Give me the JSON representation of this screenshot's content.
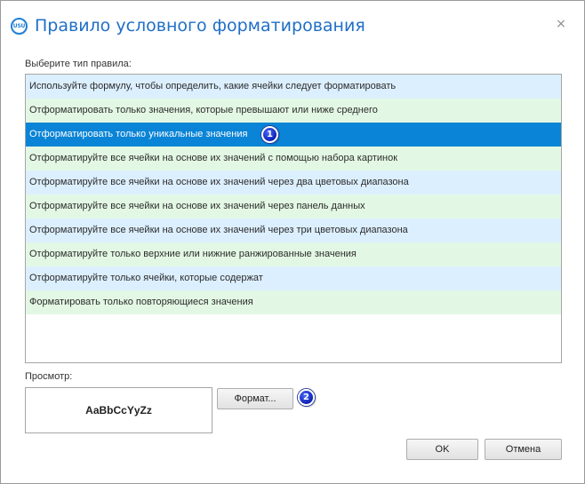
{
  "window": {
    "icon_text": "USU",
    "title": "Правило условного форматирования",
    "close_glyph": "×"
  },
  "rule_type_label": "Выберите тип правила:",
  "rules": [
    {
      "label": "Используйте формулу, чтобы определить, какие ячейки следует форматировать",
      "tint": "blue"
    },
    {
      "label": "Отформатировать только значения, которые превышают или ниже среднего",
      "tint": "green"
    },
    {
      "label": "Отформатировать только уникальные значения",
      "tint": "selected"
    },
    {
      "label": "Отформатируйте все ячейки на основе их значений с помощью набора картинок",
      "tint": "green"
    },
    {
      "label": "Отформатируйте все ячейки на основе их значений через два цветовых диапазона",
      "tint": "blue"
    },
    {
      "label": "Отформатируйте все ячейки на основе их значений через панель данных",
      "tint": "green"
    },
    {
      "label": "Отформатируйте все ячейки на основе их значений через три цветовых диапазона",
      "tint": "blue"
    },
    {
      "label": "Отформатируйте только верхние или нижние ранжированные значения",
      "tint": "green"
    },
    {
      "label": "Отформатируйте только ячейки, которые содержат",
      "tint": "blue"
    },
    {
      "label": "Форматировать только повторяющиеся значения",
      "tint": "green"
    }
  ],
  "selected_rule_index": 2,
  "markers": [
    "1",
    "2"
  ],
  "preview": {
    "label": "Просмотр:",
    "sample_text": "AaBbCcYyZz"
  },
  "buttons": {
    "format_label": "Формат...",
    "ok_label": "OK",
    "cancel_label": "Отмена"
  },
  "colors": {
    "title": "#1f6fc8",
    "row_blue": "#dcefff",
    "row_green": "#e3f8e4",
    "selected": "#0a84d6",
    "marker": "#0d1fb3"
  },
  "icons": {
    "app": "usu-logo-icon",
    "close": "close-icon",
    "marker": "numbered-marker-icon"
  }
}
